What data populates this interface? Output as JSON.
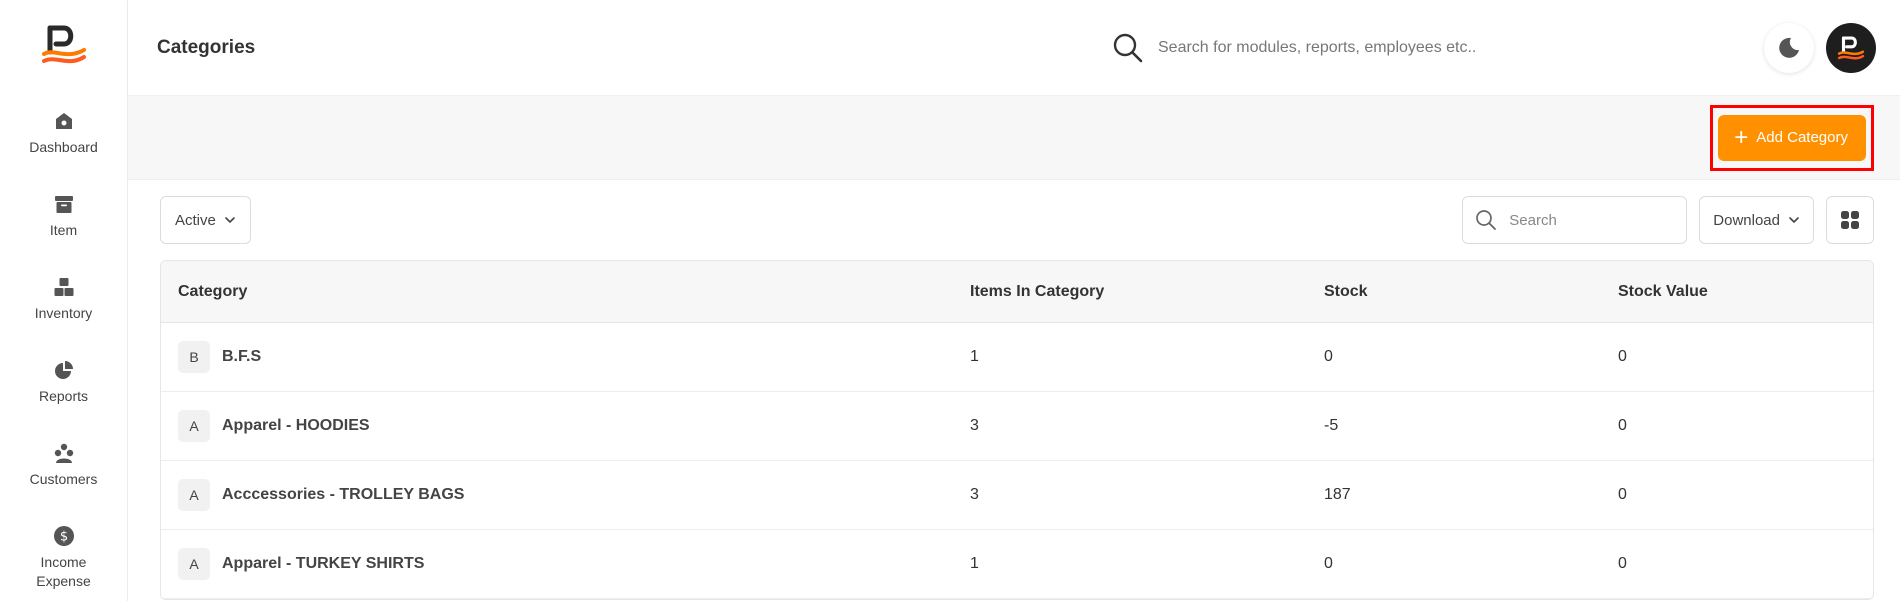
{
  "app": {
    "page_title": "Categories"
  },
  "header": {
    "search_placeholder": "Search for modules, reports, employees etc.."
  },
  "sidebar": {
    "items": [
      {
        "label": "Dashboard",
        "icon": "dashboard-icon"
      },
      {
        "label": "Item",
        "icon": "item-box-icon"
      },
      {
        "label": "Inventory",
        "icon": "inventory-boxes-icon"
      },
      {
        "label": "Reports",
        "icon": "pie-chart-icon"
      },
      {
        "label": "Customers",
        "icon": "customers-icon"
      },
      {
        "label": "Income Expense",
        "icon": "dollar-icon"
      }
    ]
  },
  "actions": {
    "add_category_label": "Add Category"
  },
  "toolbar": {
    "status_value": "Active",
    "search_placeholder": "Search",
    "download_label": "Download"
  },
  "table": {
    "headers": {
      "category": "Category",
      "items": "Items In Category",
      "stock": "Stock",
      "value": "Stock Value"
    },
    "rows": [
      {
        "initial": "B",
        "category": "B.F.S",
        "items": "1",
        "stock": "0",
        "value": "0"
      },
      {
        "initial": "A",
        "category": "Apparel - HOODIES",
        "items": "3",
        "stock": "-5",
        "value": "0"
      },
      {
        "initial": "A",
        "category": "Acccessories - TROLLEY BAGS",
        "items": "3",
        "stock": "187",
        "value": "0"
      },
      {
        "initial": "A",
        "category": "Apparel - TURKEY SHIRTS",
        "items": "1",
        "stock": "0",
        "value": "0"
      }
    ]
  },
  "colors": {
    "accent": "#ff9100",
    "highlight": "#ff0000",
    "logo_dark": "#1e1e1e"
  }
}
